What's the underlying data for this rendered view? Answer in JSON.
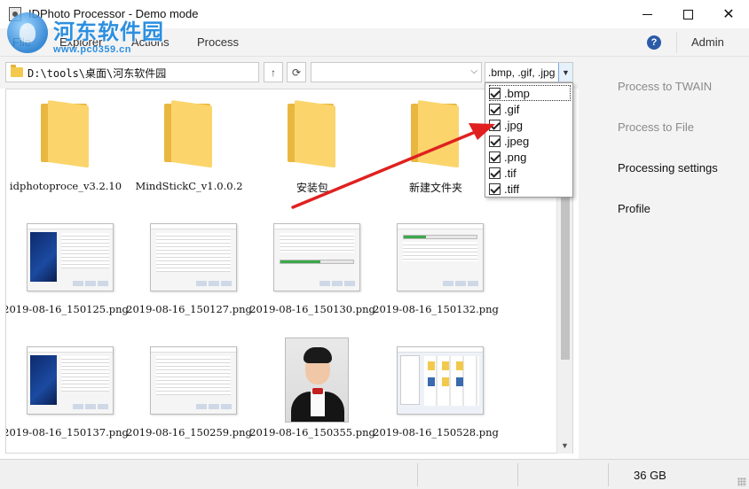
{
  "window": {
    "title": "IDPhoto Processor - Demo mode",
    "minimize_glyph": "",
    "maximize_glyph": "",
    "close_glyph": "✕"
  },
  "watermark": {
    "text": "河东软件园",
    "url": "www.pc0359.cn"
  },
  "menu": {
    "items": [
      {
        "label": "File"
      },
      {
        "label": "Explorer"
      },
      {
        "label": "Actions"
      },
      {
        "label": "Process"
      }
    ],
    "help_glyph": "?",
    "user_label": "Admin"
  },
  "address": {
    "path": "D:\\tools\\桌面\\河东软件园",
    "up_glyph": "↑",
    "refresh_glyph": "⟳",
    "filter_value": "",
    "extensions_value": ".bmp, .gif, .jpg",
    "combo_arrow_glyph": "⌵",
    "ext_arrow_glyph": "▼"
  },
  "files": [
    {
      "name": "idphotoproce_v3.2.10",
      "type": "folder"
    },
    {
      "name": "MindStickC_v1.0.0.2",
      "type": "folder"
    },
    {
      "name": "安装包",
      "type": "folder"
    },
    {
      "name": "新建文件夹",
      "type": "folder"
    },
    {
      "name": "2019-08-16_150125.png",
      "type": "installer"
    },
    {
      "name": "2019-08-16_150127.png",
      "type": "doc"
    },
    {
      "name": "2019-08-16_150130.png",
      "type": "progress"
    },
    {
      "name": "2019-08-16_150132.png",
      "type": "progress"
    },
    {
      "name": "2019-08-16_150137.png",
      "type": "installer"
    },
    {
      "name": "2019-08-16_150259.png",
      "type": "doc"
    },
    {
      "name": "2019-08-16_150355.png",
      "type": "portrait"
    },
    {
      "name": "2019-08-16_150528.png",
      "type": "app"
    }
  ],
  "extension_filter": {
    "options": [
      {
        "label": ".bmp",
        "checked": true
      },
      {
        "label": ".gif",
        "checked": true
      },
      {
        "label": ".jpg",
        "checked": true
      },
      {
        "label": ".jpeg",
        "checked": true
      },
      {
        "label": ".png",
        "checked": true
      },
      {
        "label": ".tif",
        "checked": true
      },
      {
        "label": ".tiff",
        "checked": true
      }
    ]
  },
  "right_panel": {
    "items": [
      {
        "label": "Process to TWAIN",
        "enabled": false
      },
      {
        "label": "Process to File",
        "enabled": false
      },
      {
        "label": "Processing settings",
        "enabled": true
      },
      {
        "label": "Profile",
        "enabled": true
      }
    ]
  },
  "status": {
    "disk_free": "36 GB"
  },
  "colors": {
    "annotation_arrow": "#e02020",
    "help_icon": "#2b5aa8",
    "folder": "#fbd56b"
  }
}
